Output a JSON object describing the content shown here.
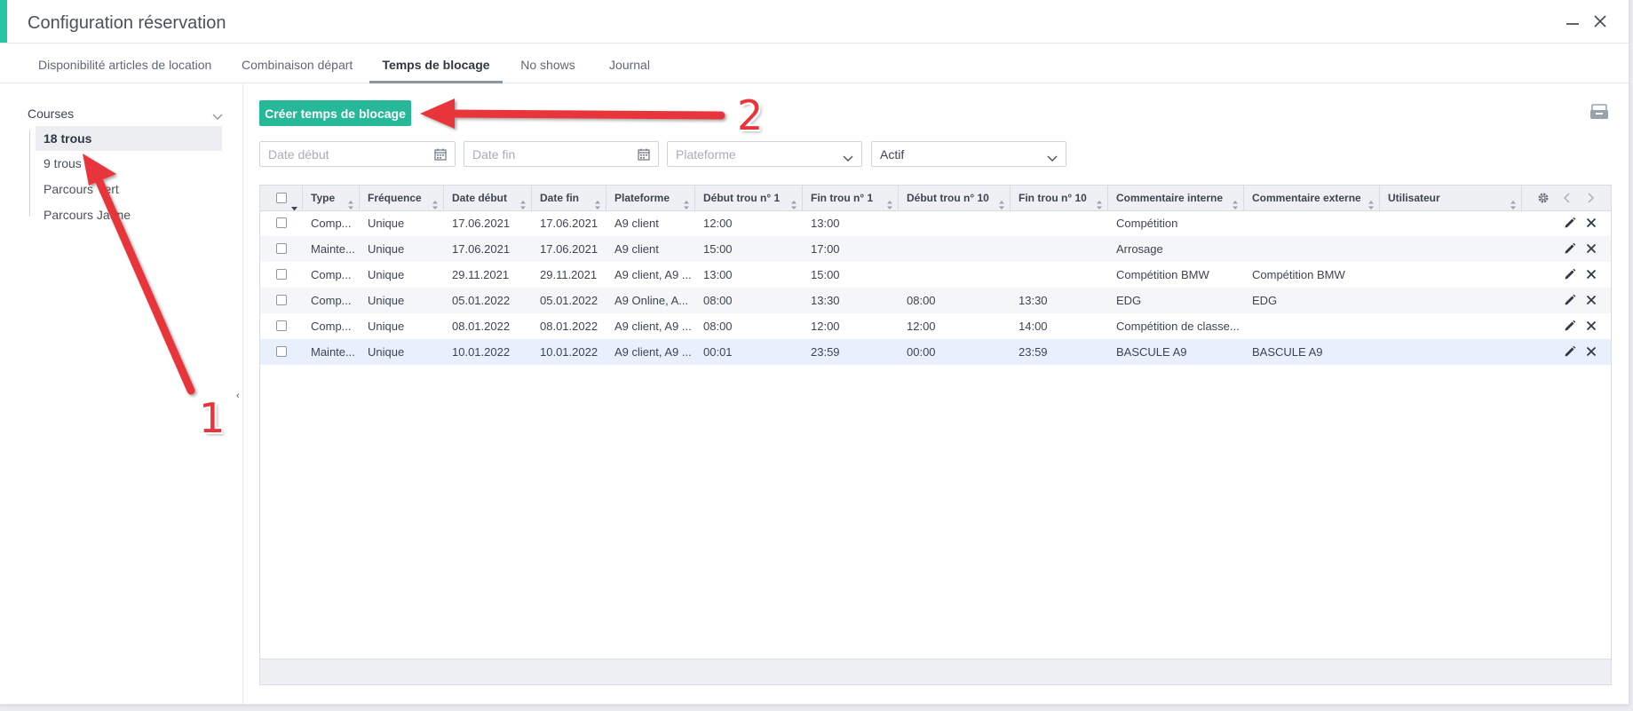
{
  "window": {
    "title": "Configuration réservation",
    "accent_color": "#26c6a2"
  },
  "tabs": [
    {
      "label": "Disponibilité articles de location",
      "active": false
    },
    {
      "label": "Combinaison départ",
      "active": false
    },
    {
      "label": "Temps de blocage",
      "active": true
    },
    {
      "label": "No shows",
      "active": false
    },
    {
      "label": "Journal",
      "active": false
    }
  ],
  "sidebar": {
    "header": "Courses",
    "items": [
      {
        "label": "18 trous",
        "selected": true
      },
      {
        "label": "9 trous",
        "selected": false
      },
      {
        "label": "Parcours Vert",
        "selected": false
      },
      {
        "label": "Parcours Jaune",
        "selected": false
      }
    ]
  },
  "toolbar": {
    "create_label": "Créer temps de blocage",
    "create_color": "#26b897"
  },
  "filters": {
    "date_start_placeholder": "Date début",
    "date_end_placeholder": "Date fin",
    "platform_placeholder": "Plateforme",
    "status_value": "Actif"
  },
  "table": {
    "columns": [
      "Type",
      "Fréquence",
      "Date début",
      "Date fin",
      "Plateforme",
      "Début trou n° 1",
      "Fin trou n° 1",
      "Début trou n° 10",
      "Fin trou n° 10",
      "Commentaire interne",
      "Commentaire externe",
      "Utilisateur"
    ],
    "rows": [
      {
        "cells": [
          "Comp...",
          "Unique",
          "17.06.2021",
          "17.06.2021",
          "A9 client",
          "12:00",
          "13:00",
          "",
          "",
          "Compétition",
          "",
          ""
        ]
      },
      {
        "cells": [
          "Mainte...",
          "Unique",
          "17.06.2021",
          "17.06.2021",
          "A9 client",
          "15:00",
          "17:00",
          "",
          "",
          "Arrosage",
          "",
          ""
        ]
      },
      {
        "cells": [
          "Comp...",
          "Unique",
          "29.11.2021",
          "29.11.2021",
          "A9 client, A9 ...",
          "13:00",
          "15:00",
          "",
          "",
          "Compétition BMW",
          "Compétition BMW",
          ""
        ]
      },
      {
        "cells": [
          "Comp...",
          "Unique",
          "05.01.2022",
          "05.01.2022",
          "A9 Online, A...",
          "08:00",
          "13:30",
          "08:00",
          "13:30",
          "EDG",
          "EDG",
          ""
        ]
      },
      {
        "cells": [
          "Comp...",
          "Unique",
          "08.01.2022",
          "08.01.2022",
          "A9 client, A9 ...",
          "08:00",
          "12:00",
          "12:00",
          "14:00",
          "Compétition de classe...",
          "",
          ""
        ]
      },
      {
        "cells": [
          "Mainte...",
          "Unique",
          "10.01.2022",
          "10.01.2022",
          "A9 client, A9 ...",
          "00:01",
          "23:59",
          "00:00",
          "23:59",
          "BASCULE A9",
          "BASCULE A9",
          ""
        ]
      }
    ]
  },
  "annotations": {
    "label_1": "1",
    "label_2": "2",
    "color": "#e8343a"
  }
}
